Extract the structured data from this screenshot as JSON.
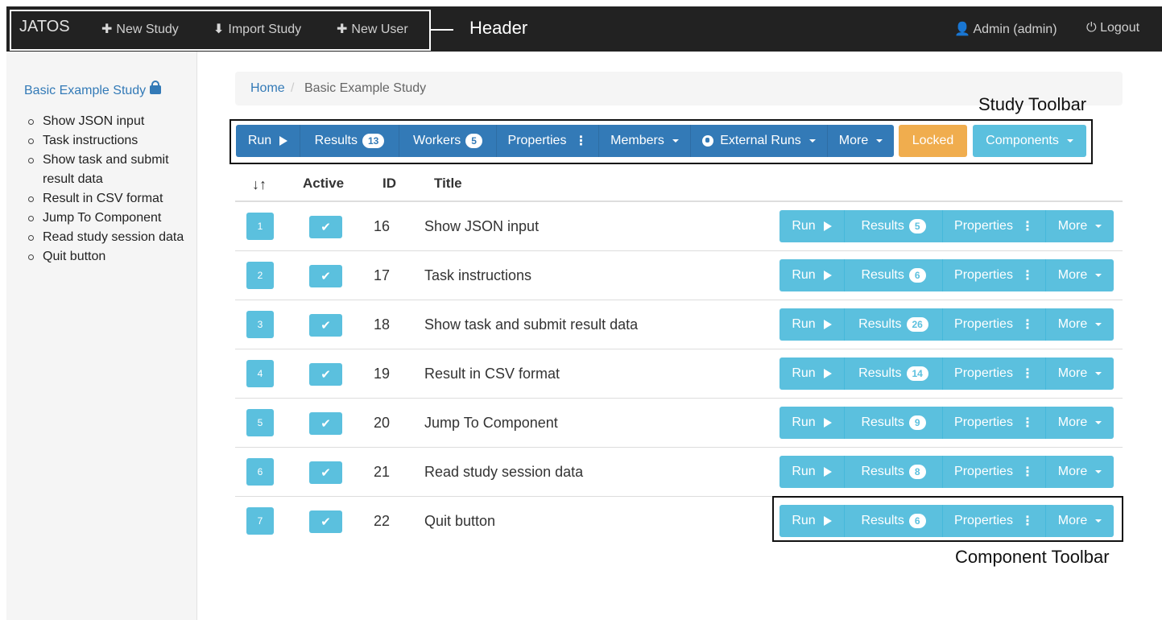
{
  "header": {
    "brand": "JATOS",
    "new_study": "New Study",
    "import_study": "Import Study",
    "new_user": "New User",
    "user": "Admin (admin)",
    "logout": "Logout",
    "annotation": "Header"
  },
  "sidebar": {
    "study_title": "Basic Example Study",
    "items": [
      "Show JSON input",
      "Task instructions",
      "Show task and submit result data",
      "Result in CSV format",
      "Jump To Component",
      "Read study session data",
      "Quit button"
    ]
  },
  "breadcrumb": {
    "home": "Home",
    "separator": "/",
    "current": "Basic Example Study"
  },
  "study_toolbar": {
    "annotation": "Study Toolbar",
    "run": "Run",
    "results": "Results",
    "results_count": "13",
    "workers": "Workers",
    "workers_count": "5",
    "properties": "Properties",
    "members": "Members",
    "external_runs": "External Runs",
    "more": "More",
    "locked": "Locked",
    "components": "Components"
  },
  "table": {
    "headers": {
      "sort": "↓↑",
      "active": "Active",
      "id": "ID",
      "title": "Title"
    },
    "rows": [
      {
        "position": "1",
        "id": "16",
        "title": "Show JSON input",
        "results": "5"
      },
      {
        "position": "2",
        "id": "17",
        "title": "Task instructions",
        "results": "6"
      },
      {
        "position": "3",
        "id": "18",
        "title": "Show task and submit result data",
        "results": "26"
      },
      {
        "position": "4",
        "id": "19",
        "title": "Result in CSV format",
        "results": "14"
      },
      {
        "position": "5",
        "id": "20",
        "title": "Jump To Component",
        "results": "9"
      },
      {
        "position": "6",
        "id": "21",
        "title": "Read study session data",
        "results": "8"
      },
      {
        "position": "7",
        "id": "22",
        "title": "Quit button",
        "results": "6"
      }
    ]
  },
  "component_toolbar": {
    "annotation": "Component Toolbar",
    "run": "Run",
    "results": "Results",
    "properties": "Properties",
    "more": "More"
  },
  "colors": {
    "navbar": "#222222",
    "primary": "#337ab7",
    "info": "#5bc0de",
    "warning": "#f0ad4e"
  }
}
